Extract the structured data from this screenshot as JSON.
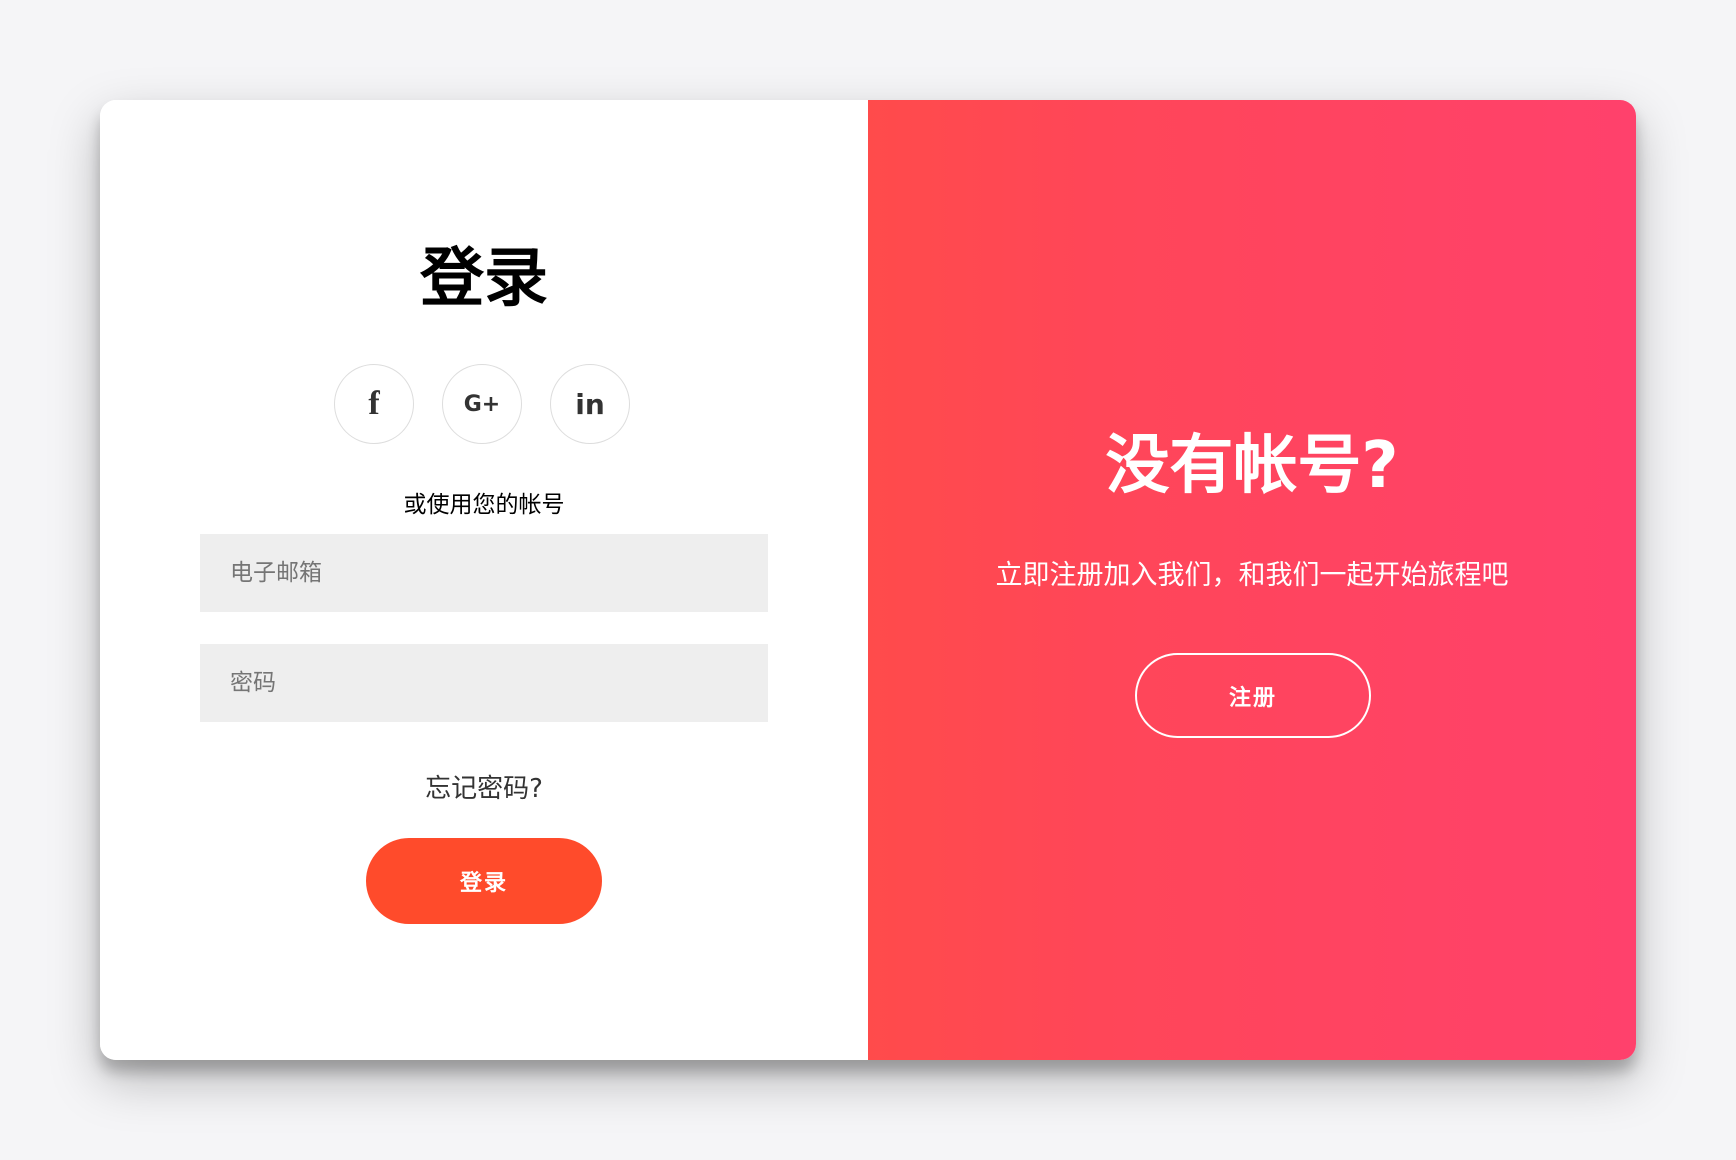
{
  "login": {
    "title": "登录",
    "social": [
      {
        "icon": "facebook-icon",
        "glyph": "f"
      },
      {
        "icon": "google-plus-icon",
        "glyph": "G+"
      },
      {
        "icon": "linkedin-icon",
        "glyph": "in"
      }
    ],
    "alt_text": "或使用您的帐号",
    "email_placeholder": "电子邮箱",
    "password_placeholder": "密码",
    "forgot_label": "忘记密码?",
    "submit_label": "登录"
  },
  "signup": {
    "title": "没有帐号?",
    "description": "立即注册加入我们，和我们一起开始旅程吧",
    "button_label": "注册"
  },
  "colors": {
    "primary": "#ff4b2b",
    "gradient_start": "#ff4b4b",
    "gradient_end": "#ff416c"
  }
}
